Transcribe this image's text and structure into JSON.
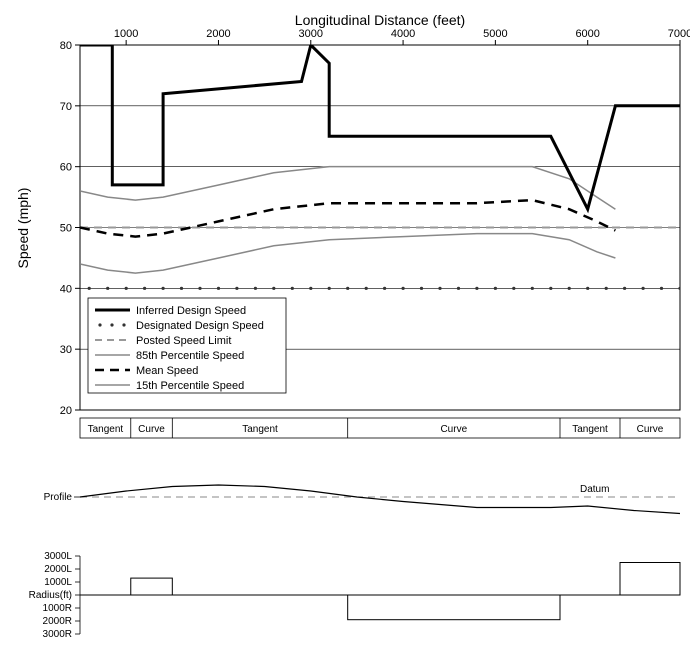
{
  "chart_data": [
    {
      "type": "line",
      "title": "",
      "xlabel": "Longitudinal Distance (feet)",
      "ylabel": "Speed (mph)",
      "xlim": [
        500,
        7000
      ],
      "ylim": [
        20,
        80
      ],
      "xticks": [
        1000,
        2000,
        3000,
        4000,
        5000,
        6000,
        7000
      ],
      "yticks": [
        20,
        30,
        40,
        50,
        60,
        70,
        80
      ],
      "series": [
        {
          "name": "Inferred Design Speed",
          "style": "solid-thick-black",
          "x": [
            500,
            850,
            850,
            1400,
            1400,
            2900,
            3000,
            3200,
            3200,
            5600,
            6000,
            6300,
            6300,
            7000
          ],
          "y": [
            80,
            80,
            57,
            57,
            72,
            74,
            80,
            77,
            65,
            65,
            53,
            70,
            70,
            70
          ]
        },
        {
          "name": "Designated Design Speed",
          "style": "dots-black",
          "x": [
            600,
            800,
            1000,
            1200,
            1400,
            1600,
            1800,
            2000,
            2200,
            2400,
            2600,
            2800,
            3000,
            3200,
            3400,
            3600,
            3800,
            4000,
            4200,
            4400,
            4600,
            4800,
            5000,
            5200,
            5400,
            5600,
            5800,
            6000,
            6200,
            6400,
            6600,
            6800,
            7000
          ],
          "y": [
            40,
            40,
            40,
            40,
            40,
            40,
            40,
            40,
            40,
            40,
            40,
            40,
            40,
            40,
            40,
            40,
            40,
            40,
            40,
            40,
            40,
            40,
            40,
            40,
            40,
            40,
            40,
            40,
            40,
            40,
            40,
            40,
            40
          ]
        },
        {
          "name": "Posted Speed Limit",
          "style": "dashed-gray",
          "x": [
            500,
            7000
          ],
          "y": [
            50,
            50
          ]
        },
        {
          "name": "85th Percentile Speed",
          "style": "solid-gray",
          "x": [
            500,
            800,
            1100,
            1400,
            2000,
            2600,
            3200,
            4000,
            4800,
            5400,
            5800,
            6100,
            6300
          ],
          "y": [
            56,
            55,
            54.5,
            55,
            57,
            59,
            60,
            60,
            60,
            60,
            58,
            55,
            53
          ]
        },
        {
          "name": "Mean Speed",
          "style": "dashed-thick-black",
          "x": [
            500,
            800,
            1100,
            1400,
            2000,
            2600,
            3200,
            4000,
            4800,
            5400,
            5800,
            6100,
            6300
          ],
          "y": [
            50,
            49,
            48.5,
            49,
            51,
            53,
            54,
            54,
            54,
            54.5,
            53,
            51,
            49.5
          ]
        },
        {
          "name": "15th Percentile Speed",
          "style": "solid-gray",
          "x": [
            500,
            800,
            1100,
            1400,
            2000,
            2600,
            3200,
            4000,
            4800,
            5400,
            5800,
            6100,
            6300
          ],
          "y": [
            44,
            43,
            42.5,
            43,
            45,
            47,
            48,
            48.5,
            49,
            49,
            48,
            46,
            45
          ]
        }
      ],
      "segments": [
        {
          "label": "Tangent",
          "xstart": 500,
          "xend": 1050
        },
        {
          "label": "Curve",
          "xstart": 1050,
          "xend": 1500
        },
        {
          "label": "Tangent",
          "xstart": 1500,
          "xend": 3400
        },
        {
          "label": "Curve",
          "xstart": 3400,
          "xend": 5700
        },
        {
          "label": "Tangent",
          "xstart": 5700,
          "xend": 6350
        },
        {
          "label": "Curve",
          "xstart": 6350,
          "xend": 7000
        }
      ],
      "legend": [
        "Inferred Design Speed",
        "Designated Design Speed",
        "Posted Speed Limit",
        "85th Percentile Speed",
        "Mean Speed",
        "15th Percentile Speed"
      ]
    },
    {
      "type": "line",
      "title": "Profile",
      "x": [
        500,
        1000,
        1500,
        2000,
        2500,
        3000,
        3500,
        4000,
        4800,
        5600,
        6000,
        6500,
        7000
      ],
      "y": [
        0,
        4,
        7,
        8,
        7,
        4,
        0,
        -3,
        -7,
        -7,
        -6,
        -9,
        -11
      ],
      "datum_label": "Datum"
    },
    {
      "type": "bar",
      "title": "Radius(ft)",
      "yticks": [
        "3000L",
        "2000L",
        "1000L",
        "Radius(ft)",
        "1000R",
        "2000R",
        "3000R"
      ],
      "segments": [
        {
          "xstart": 1050,
          "xend": 1500,
          "value": "1300L"
        },
        {
          "xstart": 3400,
          "xend": 5700,
          "value": "1900R"
        },
        {
          "xstart": 6350,
          "xend": 7000,
          "value": "2500L"
        }
      ]
    }
  ],
  "labels": {
    "xlabel": "Longitudinal Distance (feet)",
    "ylabel": "Speed (mph)",
    "profile": "Profile",
    "datum": "Datum",
    "radius": "Radius(ft)",
    "r3000L": "3000L",
    "r2000L": "2000L",
    "r1000L": "1000L",
    "r1000R": "1000R",
    "r2000R": "2000R",
    "r3000R": "3000R",
    "legend1": "Inferred Design Speed",
    "legend2": "Designated Design Speed",
    "legend3": "Posted Speed Limit",
    "legend4": "85th Percentile Speed",
    "legend5": "Mean Speed",
    "legend6": "15th Percentile Speed",
    "seg1": "Tangent",
    "seg2": "Curve",
    "seg3": "Tangent",
    "seg4": "Curve",
    "seg5": "Tangent",
    "seg6": "Curve",
    "xt1000": "1000",
    "xt2000": "2000",
    "xt3000": "3000",
    "xt4000": "4000",
    "xt5000": "5000",
    "xt6000": "6000",
    "xt7000": "7000",
    "yt20": "20",
    "yt30": "30",
    "yt40": "40",
    "yt50": "50",
    "yt60": "60",
    "yt70": "70",
    "yt80": "80"
  }
}
